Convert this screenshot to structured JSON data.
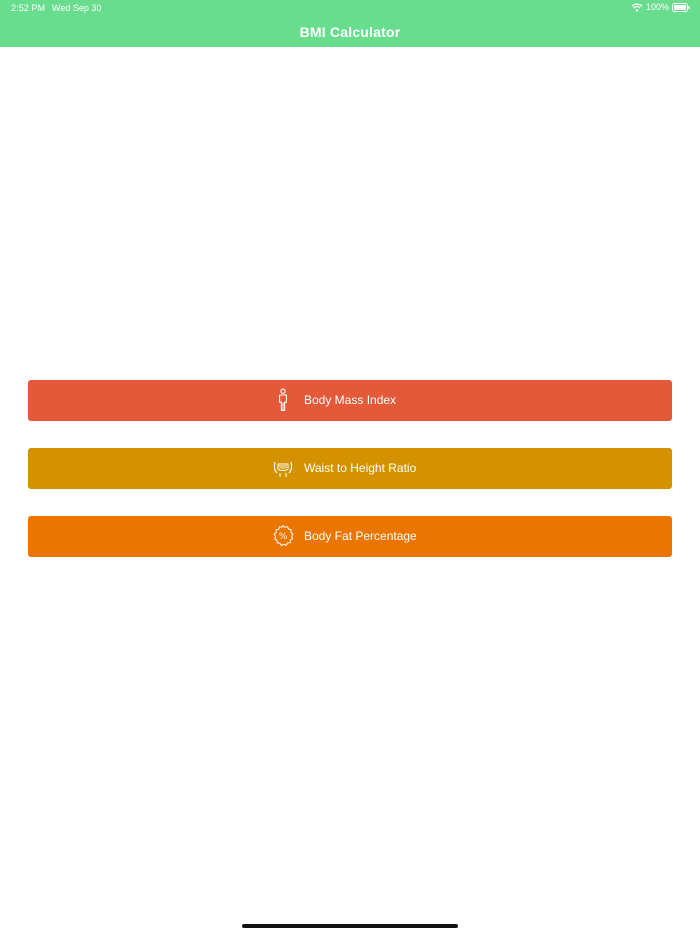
{
  "status_bar": {
    "time": "2:52 PM",
    "date": "Wed Sep 30",
    "battery": "100%"
  },
  "nav": {
    "title": "BMI Calculator"
  },
  "buttons": [
    {
      "label": "Body Mass Index",
      "icon": "person-icon",
      "color": "#E35939"
    },
    {
      "label": "Waist to Height Ratio",
      "icon": "waist-measure-icon",
      "color": "#D49200"
    },
    {
      "label": "Body Fat Percentage",
      "icon": "percent-badge-icon",
      "color": "#EA7500"
    }
  ],
  "colors": {
    "header": "#69DD8E",
    "background": "#FFFFFF"
  }
}
